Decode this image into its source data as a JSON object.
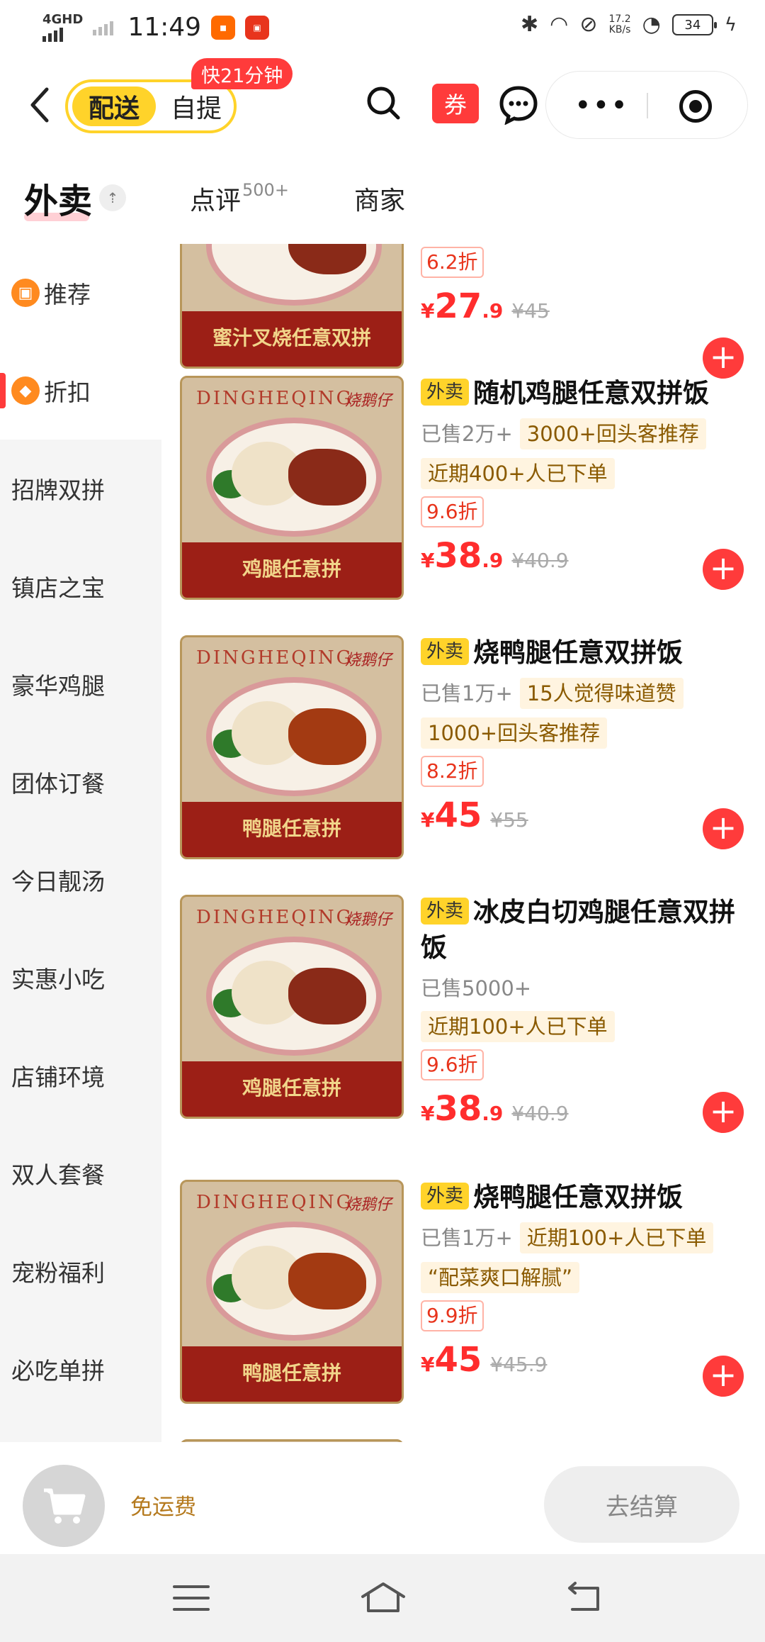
{
  "status_bar": {
    "network": "4GHD",
    "time": "11:49",
    "speed_value": "17.2",
    "speed_unit": "KB/s",
    "battery": "34"
  },
  "header": {
    "mode_active": "配送",
    "mode_inactive": "自提",
    "fast_badge": "快21分钟",
    "coupon_label": "券"
  },
  "tabs": {
    "main": "外卖",
    "reviews": "点评",
    "reviews_count": "500+",
    "merchant": "商家"
  },
  "sidebar": {
    "items": [
      {
        "label": "推荐"
      },
      {
        "label": "折扣"
      },
      {
        "label": "招牌双拼"
      },
      {
        "label": "镇店之宝"
      },
      {
        "label": "豪华鸡腿"
      },
      {
        "label": "团体订餐"
      },
      {
        "label": "今日靓汤"
      },
      {
        "label": "实惠小吃"
      },
      {
        "label": "店铺环境"
      },
      {
        "label": "双人套餐"
      },
      {
        "label": "宠粉福利"
      },
      {
        "label": "必吃单拼"
      }
    ]
  },
  "products": [
    {
      "thumb_text": "蜜汁叉烧任意双拼",
      "discount": "6.2折",
      "price_cur": "¥",
      "price_int": "27",
      "price_dec": ".9",
      "orig_price": "¥45"
    },
    {
      "tag": "外卖",
      "title": "随机鸡腿任意双拼饭",
      "sold": "已售2万+",
      "pills": [
        "3000+回头客推荐",
        "近期400+人已下单"
      ],
      "discount": "9.6折",
      "price_cur": "¥",
      "price_int": "38",
      "price_dec": ".9",
      "orig_price": "¥40.9",
      "thumb_brand": "DINGHEQING",
      "thumb_brand_cn": "烧鹅仔",
      "thumb_text": "鸡腿任意拼"
    },
    {
      "tag": "外卖",
      "title": "烧鸭腿任意双拼饭",
      "sold": "已售1万+",
      "pills": [
        "15人觉得味道赞",
        "1000+回头客推荐"
      ],
      "discount": "8.2折",
      "price_cur": "¥",
      "price_int": "45",
      "price_dec": "",
      "orig_price": "¥55",
      "thumb_brand": "DINGHEQING",
      "thumb_brand_cn": "烧鹅仔",
      "thumb_text": "鸭腿任意拼"
    },
    {
      "tag": "外卖",
      "title": "冰皮白切鸡腿任意双拼饭",
      "sold": "已售5000+",
      "pills": [
        "近期100+人已下单"
      ],
      "discount": "9.6折",
      "price_cur": "¥",
      "price_int": "38",
      "price_dec": ".9",
      "orig_price": "¥40.9",
      "thumb_brand": "DINGHEQING",
      "thumb_brand_cn": "烧鹅仔",
      "thumb_text": "鸡腿任意拼"
    },
    {
      "tag": "外卖",
      "title": "烧鸭腿任意双拼饭",
      "sold": "已售1万+",
      "pills": [
        "近期100+人已下单",
        "“配菜爽口解腻”"
      ],
      "discount": "9.9折",
      "price_cur": "¥",
      "price_int": "45",
      "price_dec": "",
      "orig_price": "¥45.9",
      "thumb_brand": "DINGHEQING",
      "thumb_brand_cn": "烧鹅仔",
      "thumb_text": "鸭腿任意拼"
    }
  ],
  "cart": {
    "free_shipping": "免运费",
    "checkout": "去结算"
  },
  "colors": {
    "accent_yellow": "#ffd32a",
    "price_red": "#ff2d2d",
    "add_red": "#ff3b3b"
  }
}
